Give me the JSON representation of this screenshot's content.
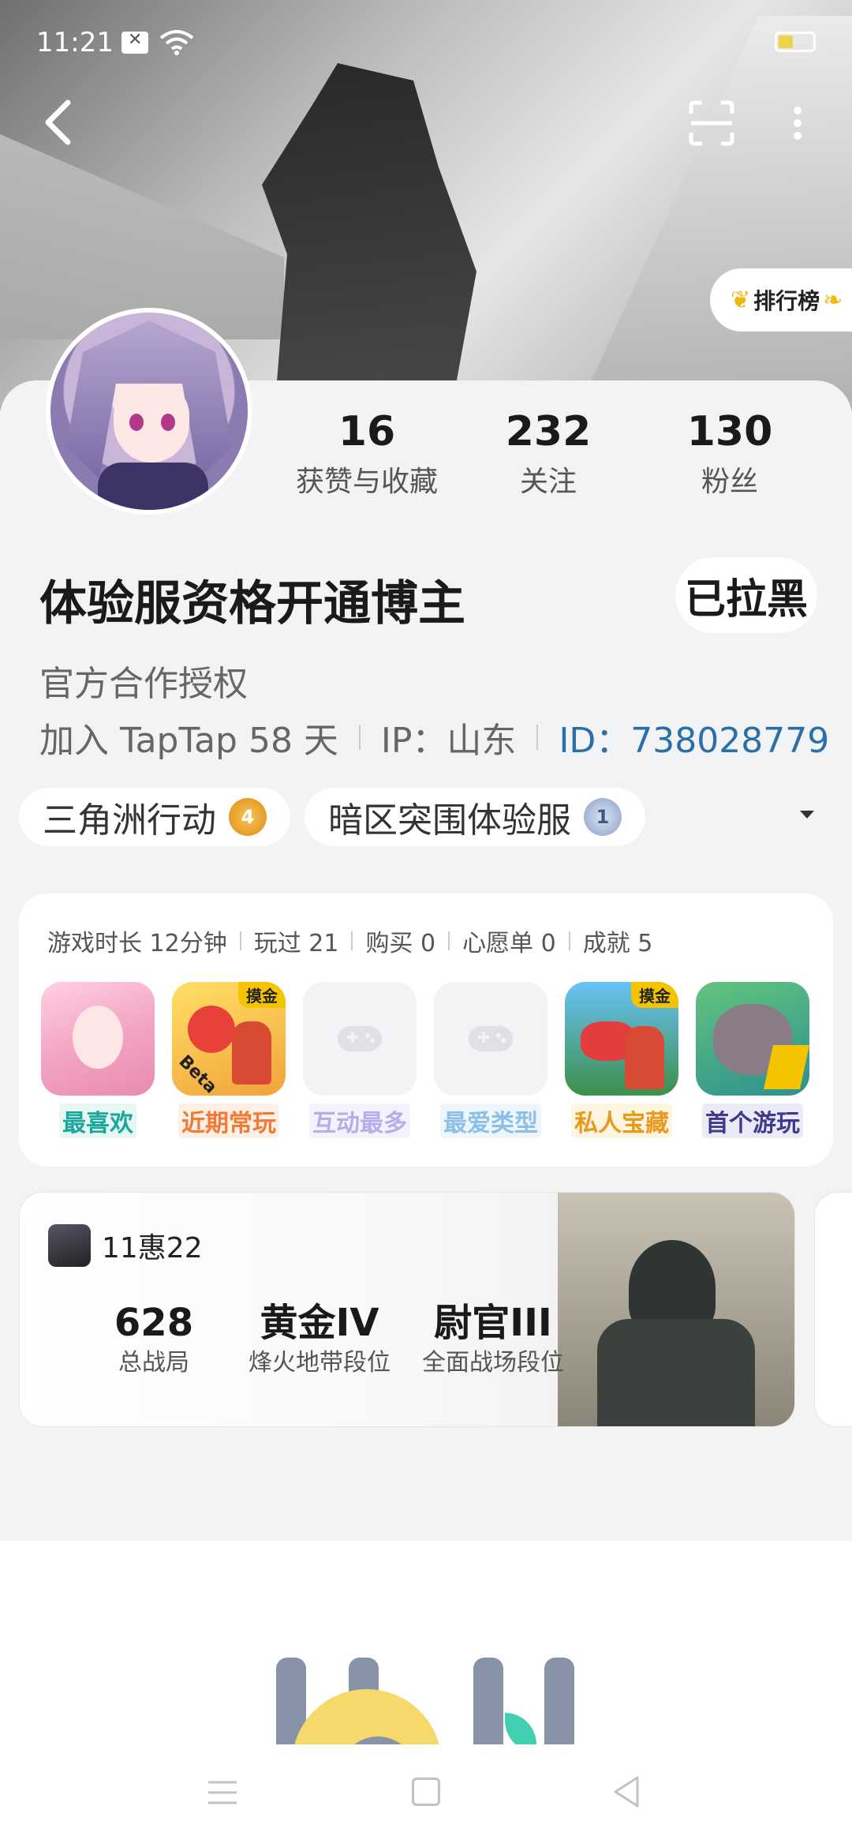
{
  "status_bar": {
    "time": "11:21"
  },
  "header": {
    "rank_label": "排行榜"
  },
  "profile": {
    "stats": [
      {
        "value": "16",
        "label": "获赞与收藏"
      },
      {
        "value": "232",
        "label": "关注"
      },
      {
        "value": "130",
        "label": "粉丝"
      }
    ],
    "name": "体验服资格开通博主",
    "blocked_label": "已拉黑",
    "description": "官方合作授权",
    "joined": "加入 TapTap 58 天",
    "ip": "IP：山东",
    "id": "ID：738028779"
  },
  "tags": [
    {
      "label": "三角洲行动",
      "badge": "4"
    },
    {
      "label": "暗区突围体验服",
      "badge": "1"
    }
  ],
  "games": {
    "meta": [
      "游戏时长 12分钟",
      "玩过 21",
      "购买 0",
      "心愿单 0",
      "成就 5"
    ],
    "tiles": [
      {
        "label": "最喜欢",
        "color": "#1aa89a",
        "bg": "#e6f7f4",
        "corner": ""
      },
      {
        "label": "近期常玩",
        "color": "#f07a36",
        "bg": "#fff0e6",
        "corner": "摸金",
        "extra": "Beta"
      },
      {
        "label": "互动最多",
        "color": "#b7aee8",
        "bg": "#f4f2fc",
        "corner": ""
      },
      {
        "label": "最爱类型",
        "color": "#8cc0e8",
        "bg": "#eef6fc",
        "corner": ""
      },
      {
        "label": "私人宝藏",
        "color": "#e89a1a",
        "bg": "#fdf4e2",
        "corner": "摸金"
      },
      {
        "label": "首个游玩",
        "color": "#3e3a8c",
        "bg": "#eceaf7",
        "corner": ""
      }
    ]
  },
  "battle": {
    "game_name": "11惠22",
    "stats": [
      {
        "value": "628",
        "label": "总战局"
      },
      {
        "value": "黄金IV",
        "label": "烽火地带段位"
      },
      {
        "value": "尉官III",
        "label": "全面战场段位"
      }
    ]
  }
}
